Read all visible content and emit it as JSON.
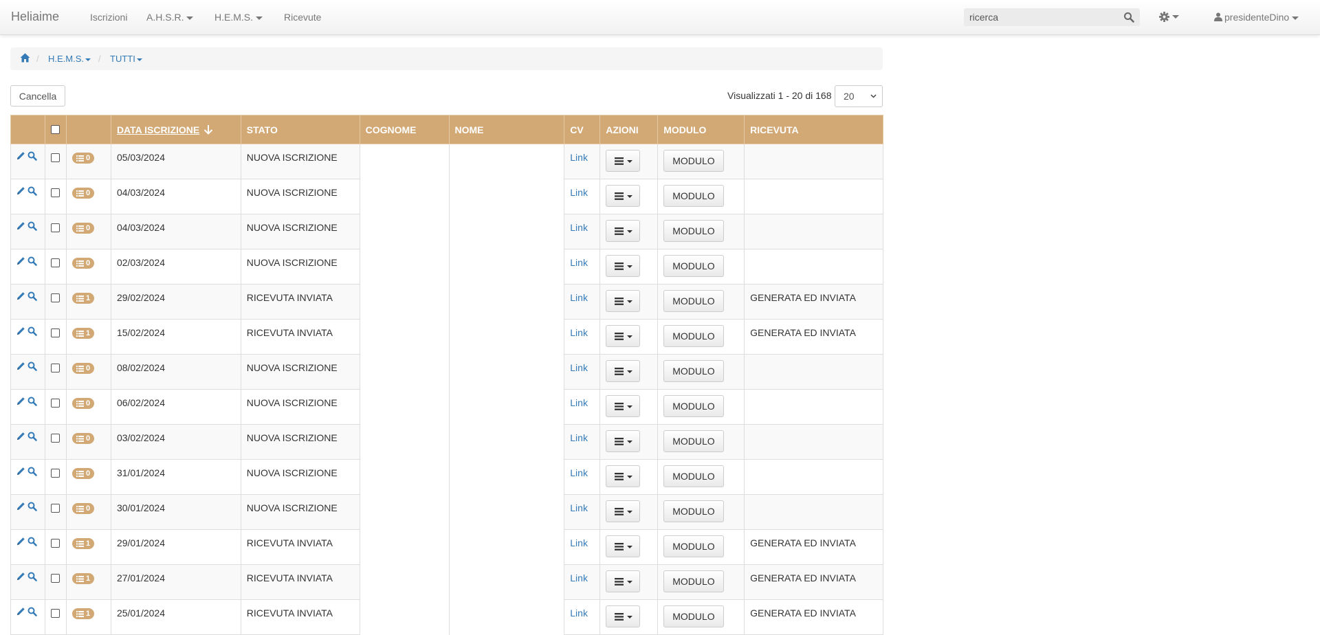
{
  "navbar": {
    "brand": "Heliaime",
    "items": [
      {
        "label": "Iscrizioni",
        "dropdown": false
      },
      {
        "label": "A.H.S.R.",
        "dropdown": true
      },
      {
        "label": "H.E.M.S.",
        "dropdown": true
      },
      {
        "label": "Ricevute",
        "dropdown": false
      }
    ],
    "search_placeholder": "ricerca",
    "user": "presidenteDino"
  },
  "breadcrumb": {
    "items": [
      "H.E.M.S.",
      "TUTTI"
    ]
  },
  "toolbar": {
    "cancel_label": "Cancella",
    "pagination_text": "Visualizzati 1 - 20 di 168",
    "page_size": "20"
  },
  "table": {
    "headers": {
      "data": "DATA ISCRIZIONE",
      "stato": "STATO",
      "cognome": "COGNOME",
      "nome": "NOME",
      "cv": "CV",
      "azioni": "AZIONI",
      "modulo": "MODULO",
      "ricevuta": "RICEVUTA"
    },
    "link_label": "Link",
    "modulo_label": "MODULO",
    "rows": [
      {
        "badge": "0",
        "date": "05/03/2024",
        "status": "NUOVA ISCRIZIONE",
        "ricevuta": ""
      },
      {
        "badge": "0",
        "date": "04/03/2024",
        "status": "NUOVA ISCRIZIONE",
        "ricevuta": ""
      },
      {
        "badge": "0",
        "date": "04/03/2024",
        "status": "NUOVA ISCRIZIONE",
        "ricevuta": ""
      },
      {
        "badge": "0",
        "date": "02/03/2024",
        "status": "NUOVA ISCRIZIONE",
        "ricevuta": ""
      },
      {
        "badge": "1",
        "date": "29/02/2024",
        "status": "RICEVUTA INVIATA",
        "ricevuta": "GENERATA ED INVIATA"
      },
      {
        "badge": "1",
        "date": "15/02/2024",
        "status": "RICEVUTA INVIATA",
        "ricevuta": "GENERATA ED INVIATA"
      },
      {
        "badge": "0",
        "date": "08/02/2024",
        "status": "NUOVA ISCRIZIONE",
        "ricevuta": ""
      },
      {
        "badge": "0",
        "date": "06/02/2024",
        "status": "NUOVA ISCRIZIONE",
        "ricevuta": ""
      },
      {
        "badge": "0",
        "date": "03/02/2024",
        "status": "NUOVA ISCRIZIONE",
        "ricevuta": ""
      },
      {
        "badge": "0",
        "date": "31/01/2024",
        "status": "NUOVA ISCRIZIONE",
        "ricevuta": ""
      },
      {
        "badge": "0",
        "date": "30/01/2024",
        "status": "NUOVA ISCRIZIONE",
        "ricevuta": ""
      },
      {
        "badge": "1",
        "date": "29/01/2024",
        "status": "RICEVUTA INVIATA",
        "ricevuta": "GENERATA ED INVIATA"
      },
      {
        "badge": "1",
        "date": "27/01/2024",
        "status": "RICEVUTA INVIATA",
        "ricevuta": "GENERATA ED INVIATA"
      },
      {
        "badge": "1",
        "date": "25/01/2024",
        "status": "RICEVUTA INVIATA",
        "ricevuta": "GENERATA ED INVIATA"
      }
    ]
  },
  "colors": {
    "accent": "#d2a874",
    "link": "#337ab7"
  }
}
